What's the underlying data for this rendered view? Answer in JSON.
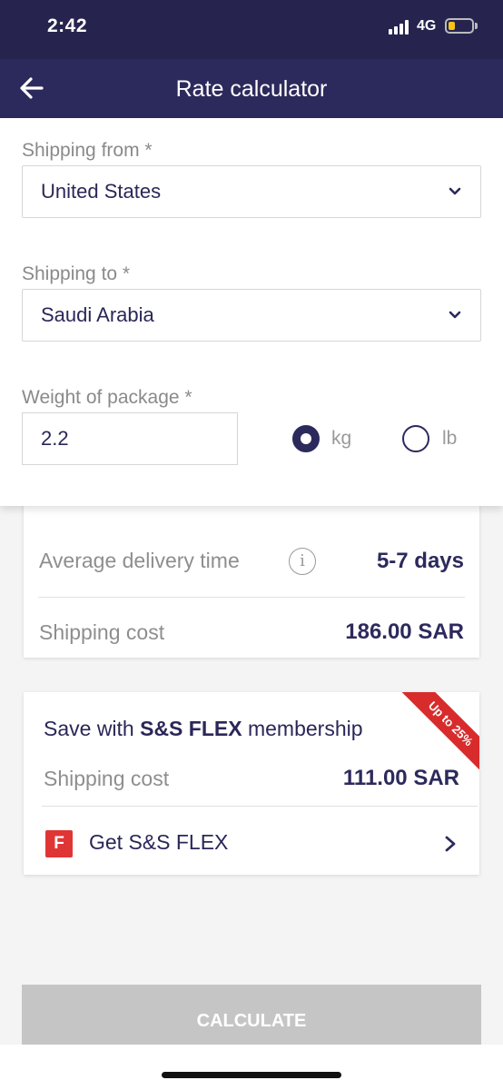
{
  "status_bar": {
    "time": "2:42",
    "network": "4G",
    "battery_color": "#f5c518"
  },
  "nav": {
    "title": "Rate calculator",
    "back_icon": "arrow-left-icon"
  },
  "form": {
    "from_label": "Shipping from *",
    "from_value": "United States",
    "to_label": "Shipping to *",
    "to_value": "Saudi Arabia",
    "weight_label": "Weight of package *",
    "weight_value": "2.2",
    "unit_options": [
      "kg",
      "lb"
    ],
    "selected_unit": "kg"
  },
  "result": {
    "delivery_label": "Average delivery time",
    "delivery_value": "5-7 days",
    "cost_label": "Shipping cost",
    "cost_value": "186.00 SAR"
  },
  "flex": {
    "title_prefix": "Save with ",
    "title_brand": "S&S FLEX",
    "title_suffix": " membership",
    "ribbon": "Up to 25%",
    "cost_label": "Shipping cost",
    "cost_value": "111.00 SAR",
    "logo_letter": "F",
    "link_label": "Get S&S FLEX"
  },
  "calculate_label": "CALCULATE",
  "colors": {
    "brand_dark": "#2c2a5c",
    "accent_red": "#d82c2c",
    "disabled": "#c5c5c5"
  }
}
